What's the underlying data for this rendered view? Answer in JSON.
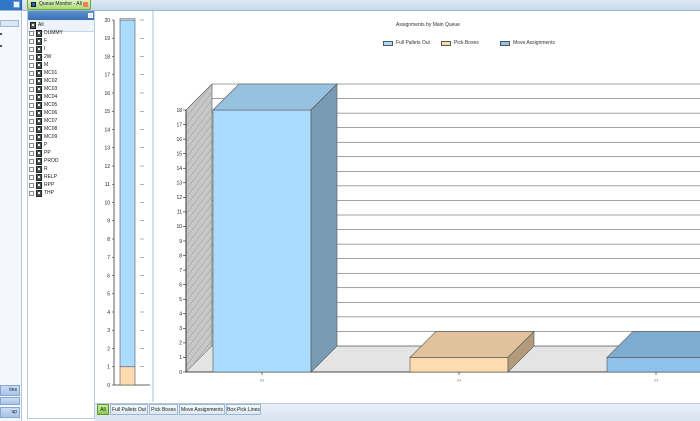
{
  "window": {
    "tab_title": "Queue Monitor - All"
  },
  "left_panel": {
    "buttons": [
      "ites",
      "",
      "up"
    ]
  },
  "queue_tree": {
    "items": [
      "All",
      "DUMMY",
      "F",
      "I",
      "2W",
      "M",
      "MC01",
      "MC02",
      "MC03",
      "MC04",
      "MC05",
      "MC06",
      "MC07",
      "MC08",
      "MC09",
      "P",
      "PP",
      "PROD",
      "R",
      "RELP",
      "RPP",
      "THP"
    ]
  },
  "colors": {
    "full_pallets": "#abdcff",
    "pick_boxes": "#ffdcb0",
    "move_assignments": "#8fc3ee",
    "active_tab": "#a8dc70"
  },
  "chart_data": [
    {
      "type": "bar",
      "stacked": true,
      "series": [
        {
          "name": "Pick Boxes",
          "values": [
            1
          ]
        },
        {
          "name": "Full Pallets Out",
          "values": [
            19
          ]
        }
      ],
      "ylim": [
        0,
        20
      ],
      "yticks": [
        "0",
        "1",
        "2",
        "3",
        "4",
        "5",
        "6",
        "7",
        "8",
        "9",
        "10",
        "11",
        "12",
        "13",
        "14",
        "15",
        "16",
        "17",
        "18",
        "19",
        "20"
      ]
    },
    {
      "type": "bar",
      "title": "Assignments by Main Queue",
      "categories": [
        "",
        "",
        " "
      ],
      "category_labels": [
        "??",
        "??",
        "??"
      ],
      "series": [
        {
          "name": "Full Pallets Out",
          "values": [
            18,
            0,
            0
          ]
        },
        {
          "name": "Pick Boxes",
          "values": [
            0,
            1,
            0
          ]
        },
        {
          "name": "Move Assignments",
          "values": [
            0,
            0,
            1
          ]
        }
      ],
      "ylim": [
        0,
        18
      ],
      "yticks": [
        "0",
        "1",
        "2",
        "3",
        "4",
        "5",
        "6",
        "7",
        "8",
        "9",
        "10",
        "11",
        "12",
        "13",
        "14",
        "15",
        "16",
        "17",
        "18"
      ],
      "legend": [
        "Full Pallets Out",
        "Pick Boxes",
        "Move Assignments"
      ],
      "legend_position": "top",
      "grid": true,
      "three_d": true
    }
  ],
  "bottom_tabs": [
    "All",
    "Full Pallets Out",
    "Pick Boxes",
    "Move Assignments",
    "Box Pick Lines"
  ]
}
